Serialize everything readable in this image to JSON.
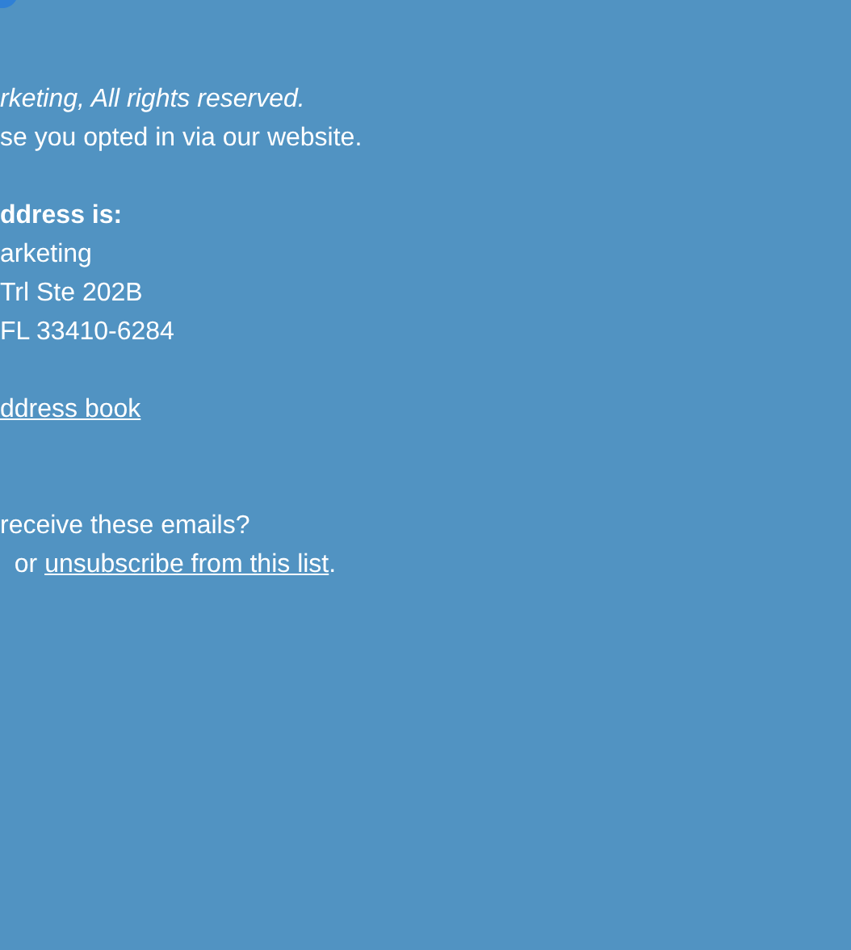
{
  "footer": {
    "copyright": "rketing, All rights reserved.",
    "reason": "se you opted in via our website.",
    "address_heading": "ddress is:",
    "address_lines": [
      "arketing",
      "Trl Ste 202B",
      "FL 33410-6284"
    ],
    "address_book_link": "ddress book",
    "preferences_question": "receive these emails?",
    "unsubscribe": {
      "prefix": "or",
      "link": "unsubscribe from this list",
      "suffix": "."
    }
  }
}
